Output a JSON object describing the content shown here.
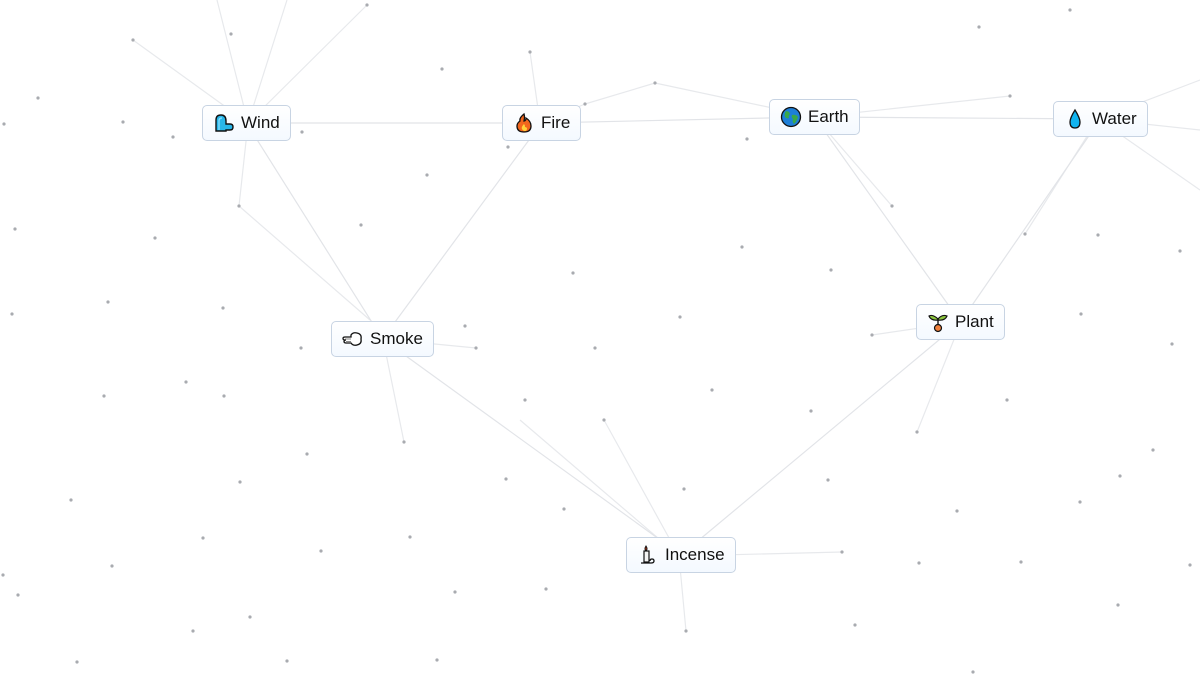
{
  "app": {
    "name": "Infinite Craft canvas"
  },
  "colors": {
    "background": "#ffffff",
    "node_border": "#c8d4e3",
    "line": "#e2e4e8",
    "particle": "#a9abb0"
  },
  "nodes": [
    {
      "id": "wind",
      "label": "Wind",
      "icon": "wind-face-icon"
    },
    {
      "id": "fire",
      "label": "Fire",
      "icon": "fire-icon"
    },
    {
      "id": "earth",
      "label": "Earth",
      "icon": "globe-icon"
    },
    {
      "id": "water",
      "label": "Water",
      "icon": "droplet-icon"
    },
    {
      "id": "smoke",
      "label": "Smoke",
      "icon": "smoke-puff-icon"
    },
    {
      "id": "plant",
      "label": "Plant",
      "icon": "seedling-icon"
    },
    {
      "id": "incense",
      "label": "Incense",
      "icon": "candle-icon"
    }
  ],
  "connections": [
    [
      "wind",
      "fire"
    ],
    [
      "fire",
      "earth"
    ],
    [
      "earth",
      "water"
    ],
    [
      "wind",
      "smoke"
    ],
    [
      "fire",
      "smoke"
    ],
    [
      "earth",
      "plant"
    ],
    [
      "water",
      "plant"
    ],
    [
      "smoke",
      "incense"
    ],
    [
      "plant",
      "incense"
    ]
  ]
}
